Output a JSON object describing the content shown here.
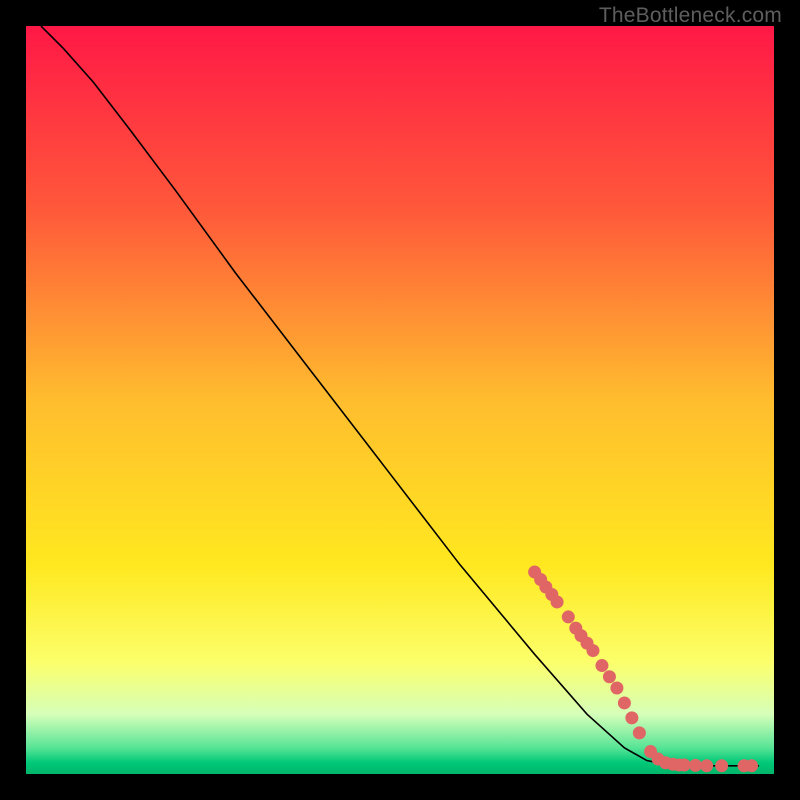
{
  "watermark": "TheBottleneck.com",
  "chart_data": {
    "type": "line",
    "title": "",
    "xlabel": "",
    "ylabel": "",
    "xlim": [
      0,
      100
    ],
    "ylim": [
      0,
      100
    ],
    "background_gradient": {
      "stops": [
        {
          "offset": 0,
          "color": "#ff1846"
        },
        {
          "offset": 25,
          "color": "#ff5a3a"
        },
        {
          "offset": 50,
          "color": "#ffbd2e"
        },
        {
          "offset": 72,
          "color": "#ffe81f"
        },
        {
          "offset": 85,
          "color": "#fcff6a"
        },
        {
          "offset": 92,
          "color": "#d6ffb9"
        },
        {
          "offset": 96.5,
          "color": "#57e495"
        },
        {
          "offset": 98.5,
          "color": "#00c878"
        },
        {
          "offset": 100,
          "color": "#00b56a"
        }
      ]
    },
    "series": [
      {
        "name": "curve",
        "type": "line",
        "color": "#000000",
        "points": [
          {
            "x": 2.0,
            "y": 100.0
          },
          {
            "x": 5.0,
            "y": 97.0
          },
          {
            "x": 9.0,
            "y": 92.5
          },
          {
            "x": 14.0,
            "y": 86.0
          },
          {
            "x": 20.0,
            "y": 78.0
          },
          {
            "x": 28.0,
            "y": 67.0
          },
          {
            "x": 38.0,
            "y": 54.0
          },
          {
            "x": 48.0,
            "y": 41.0
          },
          {
            "x": 58.0,
            "y": 28.0
          },
          {
            "x": 68.0,
            "y": 16.0
          },
          {
            "x": 75.0,
            "y": 8.0
          },
          {
            "x": 80.0,
            "y": 3.5
          },
          {
            "x": 83.0,
            "y": 1.8
          },
          {
            "x": 86.0,
            "y": 1.2
          },
          {
            "x": 92.0,
            "y": 1.1
          },
          {
            "x": 98.0,
            "y": 1.1
          }
        ]
      },
      {
        "name": "highlight-dots",
        "type": "scatter",
        "color": "#e06666",
        "points": [
          {
            "x": 68.0,
            "y": 27.0
          },
          {
            "x": 68.8,
            "y": 26.0
          },
          {
            "x": 69.5,
            "y": 25.0
          },
          {
            "x": 70.3,
            "y": 24.0
          },
          {
            "x": 71.0,
            "y": 23.0
          },
          {
            "x": 72.5,
            "y": 21.0
          },
          {
            "x": 73.5,
            "y": 19.5
          },
          {
            "x": 74.2,
            "y": 18.5
          },
          {
            "x": 75.0,
            "y": 17.5
          },
          {
            "x": 75.8,
            "y": 16.5
          },
          {
            "x": 77.0,
            "y": 14.5
          },
          {
            "x": 78.0,
            "y": 13.0
          },
          {
            "x": 79.0,
            "y": 11.5
          },
          {
            "x": 80.0,
            "y": 9.5
          },
          {
            "x": 81.0,
            "y": 7.5
          },
          {
            "x": 82.0,
            "y": 5.5
          },
          {
            "x": 83.5,
            "y": 3.0
          },
          {
            "x": 84.5,
            "y": 2.0
          },
          {
            "x": 85.5,
            "y": 1.5
          },
          {
            "x": 86.5,
            "y": 1.3
          },
          {
            "x": 87.3,
            "y": 1.2
          },
          {
            "x": 88.0,
            "y": 1.2
          },
          {
            "x": 89.5,
            "y": 1.15
          },
          {
            "x": 91.0,
            "y": 1.1
          },
          {
            "x": 93.0,
            "y": 1.1
          },
          {
            "x": 96.0,
            "y": 1.1
          },
          {
            "x": 97.0,
            "y": 1.1
          }
        ]
      }
    ]
  }
}
